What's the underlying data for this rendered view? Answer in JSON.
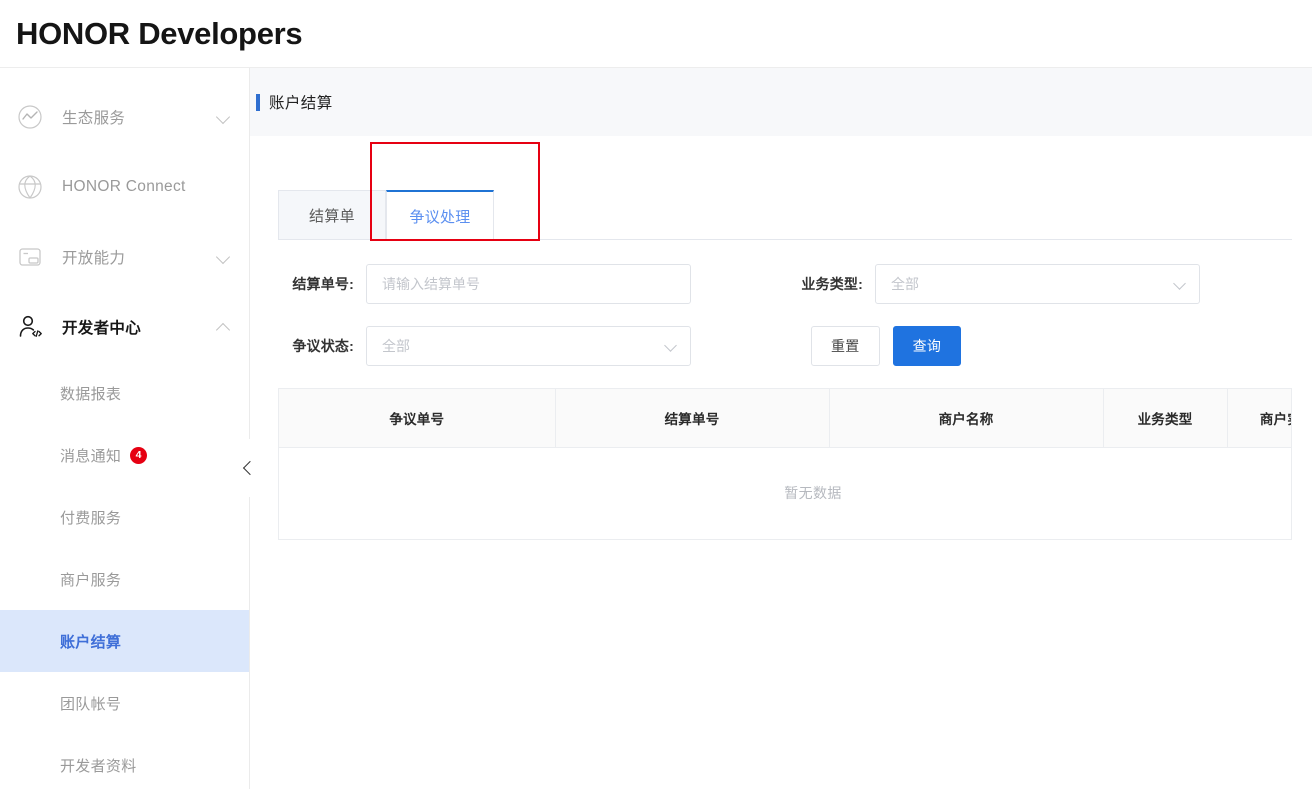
{
  "header": {
    "brand": "HONOR Developers"
  },
  "sidebar": {
    "groups": [
      {
        "label": "生态服务",
        "icon": "chart-circle-icon",
        "chevron": "down",
        "active": false
      },
      {
        "label": "HONOR Connect",
        "icon": "connect-globe-icon",
        "chevron": "none",
        "active": false
      },
      {
        "label": "开放能力",
        "icon": "window-icon",
        "chevron": "down",
        "active": false
      },
      {
        "label": "开发者中心",
        "icon": "developer-person-code-icon",
        "chevron": "up",
        "active": true
      }
    ],
    "sub_items": [
      {
        "label": "数据报表",
        "badge": "",
        "current": false
      },
      {
        "label": "消息通知",
        "badge": "4",
        "current": false
      },
      {
        "label": "付费服务",
        "badge": "",
        "current": false
      },
      {
        "label": "商户服务",
        "badge": "",
        "current": false
      },
      {
        "label": "账户结算",
        "badge": "",
        "current": true
      },
      {
        "label": "团队帐号",
        "badge": "",
        "current": false
      },
      {
        "label": "开发者资料",
        "badge": "",
        "current": false
      }
    ]
  },
  "main": {
    "page_title": "账户结算",
    "tabs": [
      {
        "label": "结算单",
        "active": false
      },
      {
        "label": "争议处理",
        "active": true
      }
    ],
    "filters": {
      "settlement_no_label": "结算单号:",
      "settlement_no_value": "",
      "settlement_no_placeholder": "请输入结算单号",
      "business_type_label": "业务类型:",
      "business_type_value": "全部",
      "dispute_status_label": "争议状态:",
      "dispute_status_value": "全部",
      "reset_button": "重置",
      "query_button": "查询"
    },
    "table": {
      "columns": [
        "争议单号",
        "结算单号",
        "商户名称",
        "业务类型",
        "商户实收"
      ],
      "rows": [],
      "empty_text": "暂无数据"
    }
  },
  "colors": {
    "brand_blue": "#1f73e0",
    "active_nav_bg": "#dbe7fb",
    "active_nav_text": "#3f6fd8",
    "badge_red": "#e60012",
    "annotation_red": "#e60012",
    "title_band_bg": "#f7f8fa"
  }
}
